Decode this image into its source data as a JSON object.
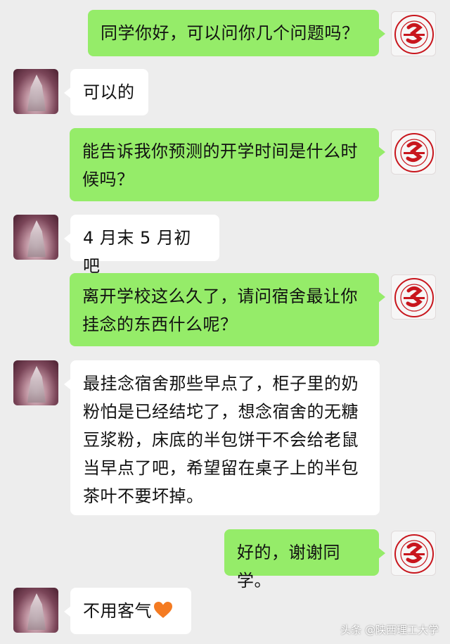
{
  "messages": [
    {
      "sender": "me",
      "text": "同学你好，可以问你几个问题吗？"
    },
    {
      "sender": "other",
      "text": "可以的"
    },
    {
      "sender": "me",
      "text": "能告诉我你预测的开学时间是什么时候吗？"
    },
    {
      "sender": "other",
      "text": "4 月末 5 月初吧"
    },
    {
      "sender": "me",
      "text": "离开学校这么久了，请问宿舍最让你挂念的东西什么呢？"
    },
    {
      "sender": "other",
      "text": "最挂念宿舍那些早点了，柜子里的奶粉怕是已经结坨了，想念宿舍的无糖豆浆粉，床底的半包饼干不会给老鼠当早点了吧，希望留在桌子上的半包茶叶不要坏掉。"
    },
    {
      "sender": "me",
      "text": "好的，谢谢同学。"
    },
    {
      "sender": "other",
      "text": "不用客气"
    }
  ],
  "heart_icon": "orange-heart-emoji",
  "colors": {
    "me_bubble": "#95ec69",
    "other_bubble": "#ffffff",
    "background": "#ededed",
    "logo_red": "#c8161d"
  },
  "watermark": "头条 @陕西理工大学"
}
